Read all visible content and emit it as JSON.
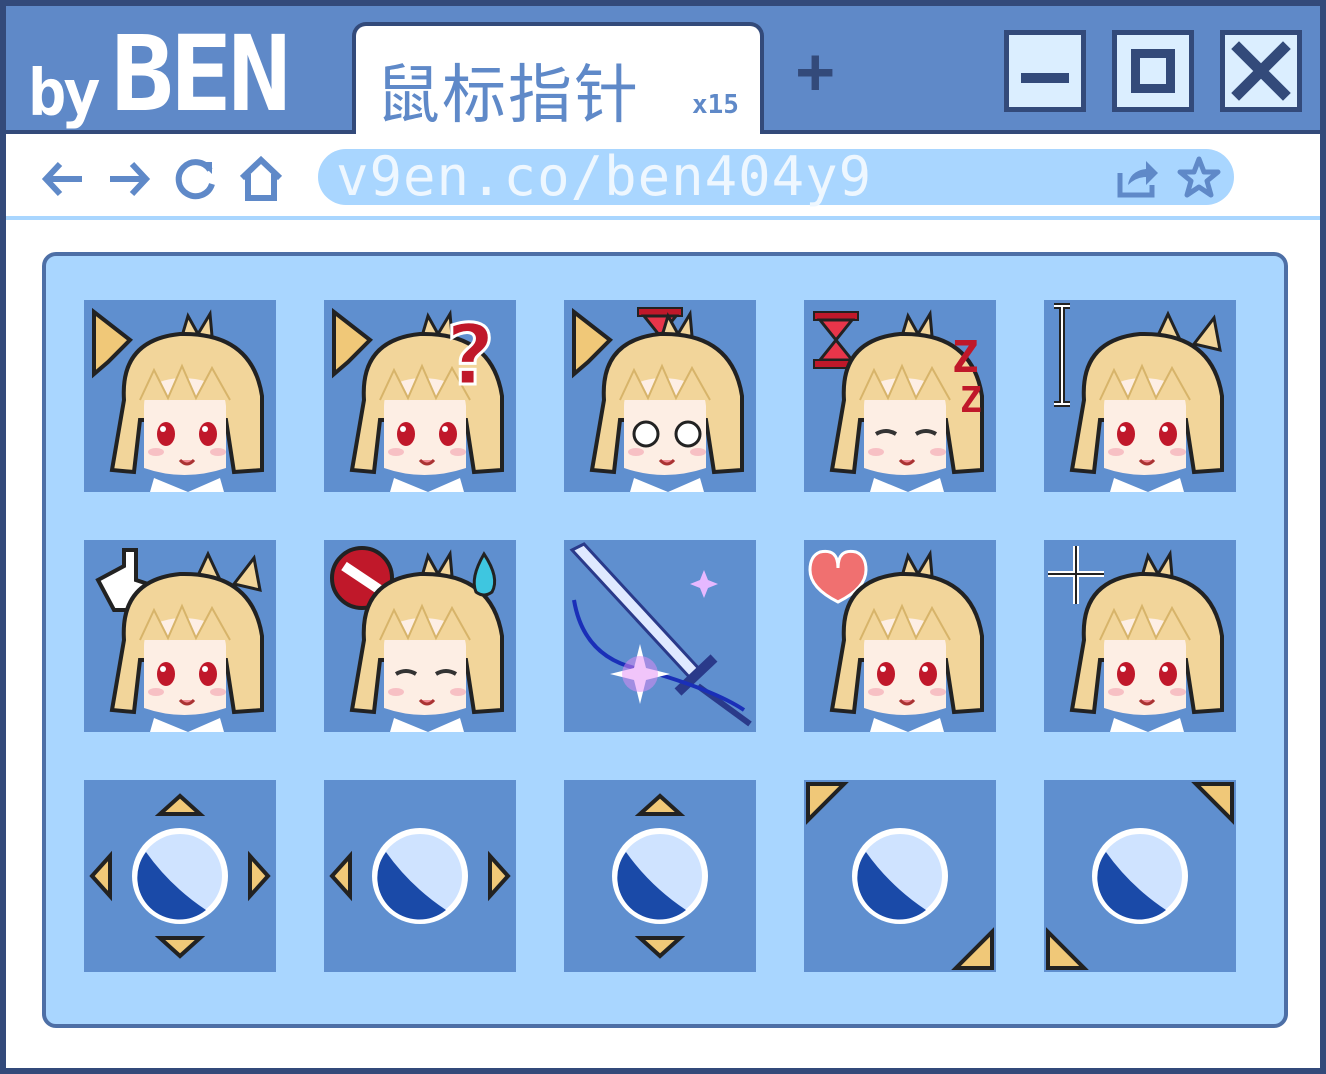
{
  "window": {
    "logo_by": "by",
    "logo_name": "BEN",
    "tab_title": "鼠标指针",
    "tab_count": "x15",
    "new_tab": "+",
    "url": "v9en.co/ben404y9"
  },
  "colors": {
    "frame": "#334a7a",
    "titlebar": "#5f89c8",
    "panel": "#a9d6ff",
    "tile": "#5f8fcf",
    "hair": "#f2d59a",
    "arrow": "#f0c878"
  },
  "cursors": [
    {
      "name": "normal-select",
      "icon": "arrow-icon"
    },
    {
      "name": "help-select",
      "icon": "question-icon"
    },
    {
      "name": "working-in-background",
      "icon": "hourglass-arrow-icon"
    },
    {
      "name": "busy",
      "icon": "hourglass-icon"
    },
    {
      "name": "text-select",
      "icon": "ibeam-icon"
    },
    {
      "name": "link-select",
      "icon": "hand-icon"
    },
    {
      "name": "unavailable",
      "icon": "no-entry-icon"
    },
    {
      "name": "handwriting",
      "icon": "sword-icon"
    },
    {
      "name": "alternate-select",
      "icon": "heart-icon"
    },
    {
      "name": "precision-select",
      "icon": "crosshair-icon"
    },
    {
      "name": "move",
      "icon": "move-icon"
    },
    {
      "name": "horizontal-resize",
      "icon": "resize-h-icon"
    },
    {
      "name": "vertical-resize",
      "icon": "resize-v-icon"
    },
    {
      "name": "diagonal-resize-1",
      "icon": "resize-d1-icon"
    },
    {
      "name": "diagonal-resize-2",
      "icon": "resize-d2-icon"
    }
  ]
}
